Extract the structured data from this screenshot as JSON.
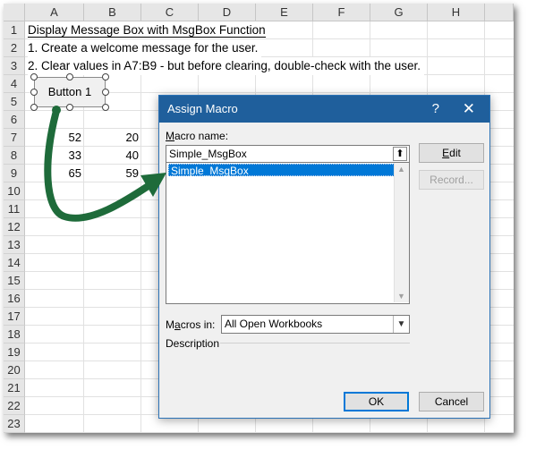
{
  "sheet": {
    "columns": [
      "A",
      "B",
      "C",
      "D",
      "E",
      "F",
      "G",
      "H"
    ],
    "rows": [
      "1",
      "2",
      "3",
      "4",
      "5",
      "6",
      "7",
      "8",
      "9",
      "10",
      "11",
      "12",
      "13",
      "14",
      "15",
      "16",
      "17",
      "18",
      "19",
      "20",
      "21",
      "22",
      "23"
    ],
    "a1": "Display Message Box with MsgBox Function",
    "a2": "1. Create a welcome message for the user.",
    "a3": "2. Clear values in A7:B9 - but before clearing, double-check with the user.",
    "data": [
      [
        "52",
        "20"
      ],
      [
        "33",
        "40"
      ],
      [
        "65",
        "59"
      ]
    ],
    "form_button_label": "Button 1"
  },
  "dialog": {
    "title": "Assign Macro",
    "help_glyph": "?",
    "close_glyph": "✕",
    "macro_name_label_accel": "M",
    "macro_name_label_rest": "acro name:",
    "macro_name_value": "Simple_MsgBox",
    "up_glyph": "⬆",
    "list_items": [
      "Simple_MsgBox"
    ],
    "edit_accel": "E",
    "edit_rest": "dit",
    "record_label": "Record...",
    "macros_in_label_pre": "M",
    "macros_in_label_accel": "a",
    "macros_in_label_rest": "cros in:",
    "macros_in_value": "All Open Workbooks",
    "description_label": "Description",
    "ok_label": "OK",
    "cancel_label": "Cancel"
  },
  "colors": {
    "titlebar": "#1f5f9c",
    "selection": "#0078d7",
    "arrow": "#1e6b3a"
  }
}
